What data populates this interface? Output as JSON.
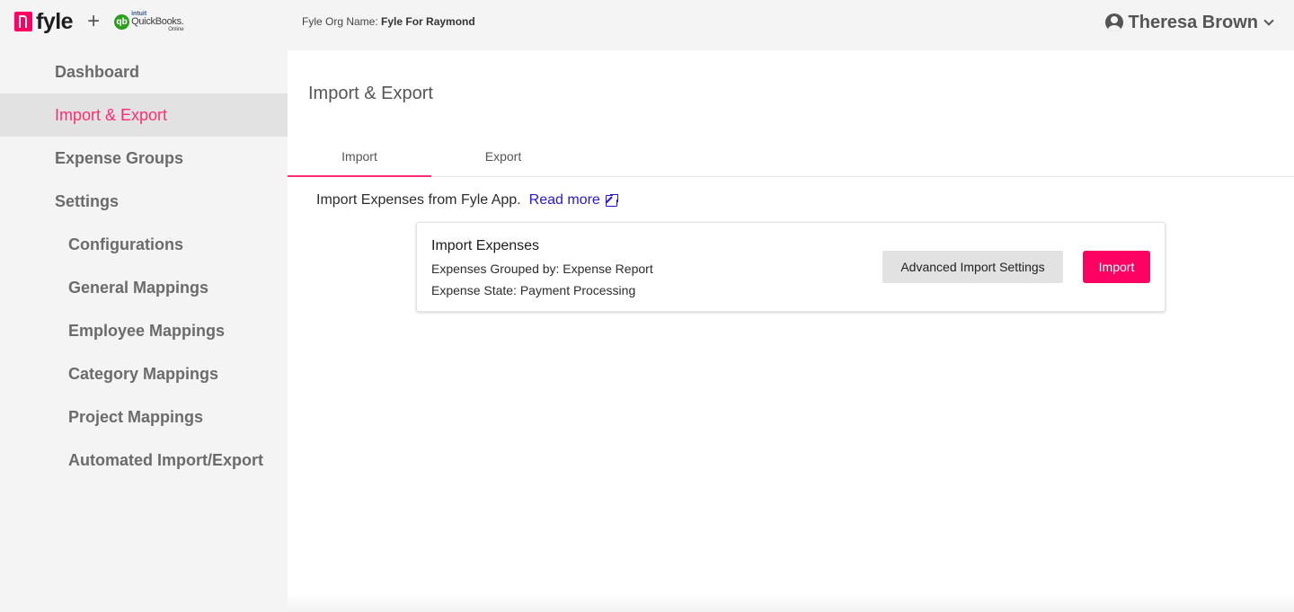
{
  "header": {
    "brand": {
      "fyle_word": "fyle",
      "plus": "+",
      "qb_mark": "qb",
      "qb_intuit": "intuit",
      "qb_name": "QuickBooks.",
      "qb_online": "Online"
    },
    "org_label": "Fyle Org Name:",
    "org_value": "Fyle For Raymond",
    "user_name": "Theresa Brown"
  },
  "sidebar": {
    "items": [
      {
        "label": "Dashboard"
      },
      {
        "label": "Import & Export"
      },
      {
        "label": "Expense Groups"
      },
      {
        "label": "Settings"
      },
      {
        "label": "Configurations"
      },
      {
        "label": "General Mappings"
      },
      {
        "label": "Employee Mappings"
      },
      {
        "label": "Category Mappings"
      },
      {
        "label": "Project Mappings"
      },
      {
        "label": "Automated Import/Export"
      }
    ]
  },
  "main": {
    "title": "Import & Export",
    "tabs": [
      {
        "label": "Import"
      },
      {
        "label": "Export"
      }
    ],
    "intro_text": "Import Expenses from Fyle App.",
    "read_more": "Read more",
    "card": {
      "title": "Import Expenses",
      "grouped_by": "Expenses Grouped by: Expense Report",
      "state": "Expense State: Payment Processing",
      "advanced_button": "Advanced Import Settings",
      "import_button": "Import"
    }
  },
  "colors": {
    "accent": "#ff0063",
    "active_nav_text": "#ff2d6f",
    "link": "#2517d6"
  }
}
